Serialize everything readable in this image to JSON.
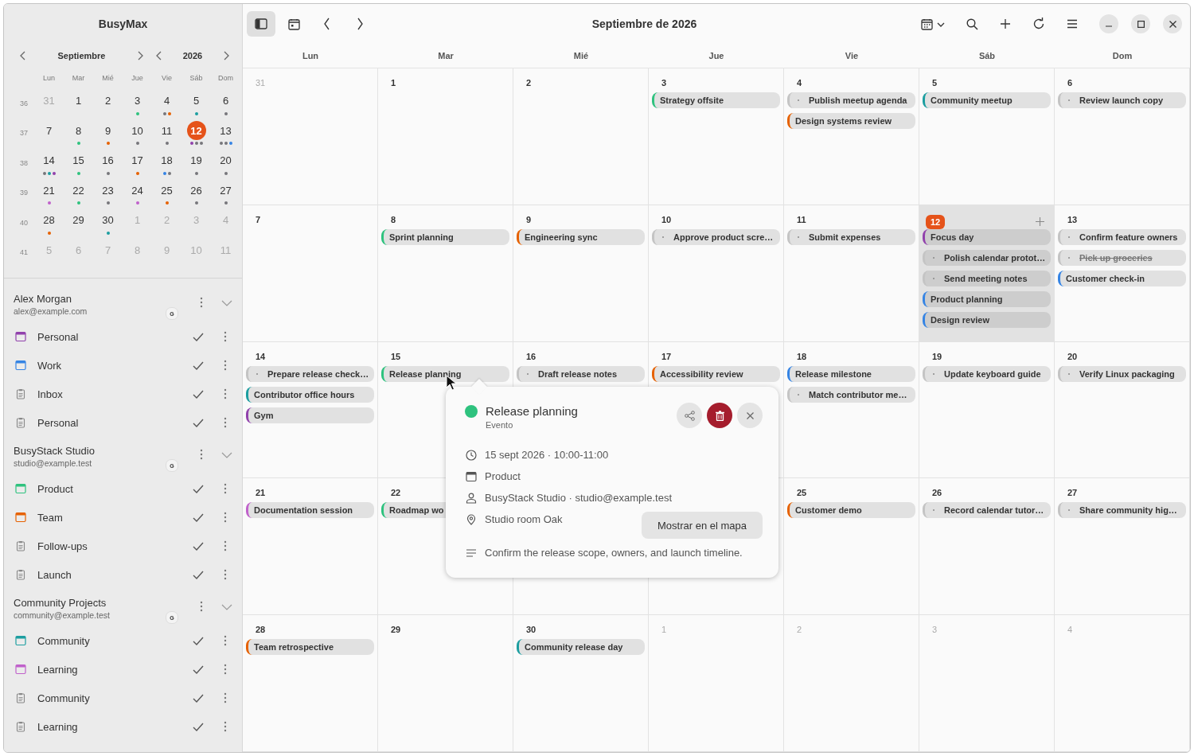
{
  "sidebar": {
    "app_title": "BusyMax",
    "mini_calendar": {
      "month": "Septiembre",
      "year": "2026",
      "weekdays": [
        "Lun",
        "Mar",
        "Mié",
        "Jue",
        "Vie",
        "Sáb",
        "Dom"
      ],
      "weeks": [
        {
          "number": "36",
          "days": [
            {
              "label": "31",
              "outside": true,
              "today": false
            },
            {
              "label": "1",
              "outside": false,
              "today": false
            },
            {
              "label": "2",
              "outside": false,
              "today": false
            },
            {
              "label": "3",
              "outside": false,
              "today": false,
              "dots": [
                {
                  "color": "#2ec27e"
                }
              ]
            },
            {
              "label": "4",
              "outside": false,
              "today": false,
              "dots": [
                {
                  "color": "#77767b"
                },
                {
                  "color": "#e66100"
                }
              ]
            },
            {
              "label": "5",
              "outside": false,
              "today": false,
              "dots": [
                {
                  "color": "#1c9ea0"
                }
              ]
            },
            {
              "label": "6",
              "outside": false,
              "today": false,
              "dots": [
                {
                  "color": "#77767b"
                }
              ]
            }
          ]
        },
        {
          "number": "37",
          "days": [
            {
              "label": "7",
              "outside": false,
              "today": false
            },
            {
              "label": "8",
              "outside": false,
              "today": false,
              "dots": [
                {
                  "color": "#2ec27e"
                }
              ]
            },
            {
              "label": "9",
              "outside": false,
              "today": false,
              "dots": [
                {
                  "color": "#e66100"
                }
              ]
            },
            {
              "label": "10",
              "outside": false,
              "today": false,
              "dots": [
                {
                  "color": "#77767b"
                }
              ]
            },
            {
              "label": "11",
              "outside": false,
              "today": false,
              "dots": [
                {
                  "color": "#77767b"
                }
              ]
            },
            {
              "label": "12",
              "outside": false,
              "today": true,
              "dots": [
                {
                  "color": "#9141ac"
                },
                {
                  "color": "#77767b"
                },
                {
                  "color": "#77767b"
                }
              ]
            },
            {
              "label": "13",
              "outside": false,
              "today": false,
              "dots": [
                {
                  "color": "#77767b"
                },
                {
                  "color": "#77767b"
                },
                {
                  "color": "#3584e4"
                }
              ]
            }
          ]
        },
        {
          "number": "38",
          "days": [
            {
              "label": "14",
              "outside": false,
              "today": false,
              "dots": [
                {
                  "color": "#77767b"
                },
                {
                  "color": "#1c9ea0"
                },
                {
                  "color": "#9141ac"
                }
              ]
            },
            {
              "label": "15",
              "outside": false,
              "today": false,
              "dots": [
                {
                  "color": "#2ec27e"
                }
              ]
            },
            {
              "label": "16",
              "outside": false,
              "today": false,
              "dots": [
                {
                  "color": "#77767b"
                }
              ]
            },
            {
              "label": "17",
              "outside": false,
              "today": false,
              "dots": [
                {
                  "color": "#e66100"
                }
              ]
            },
            {
              "label": "18",
              "outside": false,
              "today": false,
              "dots": [
                {
                  "color": "#3584e4"
                },
                {
                  "color": "#77767b"
                }
              ]
            },
            {
              "label": "19",
              "outside": false,
              "today": false,
              "dots": [
                {
                  "color": "#77767b"
                }
              ]
            },
            {
              "label": "20",
              "outside": false,
              "today": false,
              "dots": [
                {
                  "color": "#77767b"
                }
              ]
            }
          ]
        },
        {
          "number": "39",
          "days": [
            {
              "label": "21",
              "outside": false,
              "today": false,
              "dots": [
                {
                  "color": "#c061cb"
                }
              ]
            },
            {
              "label": "22",
              "outside": false,
              "today": false,
              "dots": [
                {
                  "color": "#2ec27e"
                }
              ]
            },
            {
              "label": "23",
              "outside": false,
              "today": false,
              "dots": [
                {
                  "color": "#77767b"
                }
              ]
            },
            {
              "label": "24",
              "outside": false,
              "today": false,
              "dots": [
                {
                  "color": "#c061cb"
                }
              ]
            },
            {
              "label": "25",
              "outside": false,
              "today": false,
              "dots": [
                {
                  "color": "#e66100"
                }
              ]
            },
            {
              "label": "26",
              "outside": false,
              "today": false,
              "dots": [
                {
                  "color": "#77767b"
                }
              ]
            },
            {
              "label": "27",
              "outside": false,
              "today": false,
              "dots": [
                {
                  "color": "#77767b"
                }
              ]
            }
          ]
        },
        {
          "number": "40",
          "days": [
            {
              "label": "28",
              "outside": false,
              "today": false,
              "dots": [
                {
                  "color": "#e66100"
                }
              ]
            },
            {
              "label": "29",
              "outside": false,
              "today": false
            },
            {
              "label": "30",
              "outside": false,
              "today": false,
              "dots": [
                {
                  "color": "#1c9ea0"
                }
              ]
            },
            {
              "label": "1",
              "outside": true,
              "today": false
            },
            {
              "label": "2",
              "outside": true,
              "today": false
            },
            {
              "label": "3",
              "outside": true,
              "today": false
            },
            {
              "label": "4",
              "outside": true,
              "today": false
            }
          ]
        },
        {
          "number": "41",
          "days": [
            {
              "label": "5",
              "outside": true,
              "today": false
            },
            {
              "label": "6",
              "outside": true,
              "today": false
            },
            {
              "label": "7",
              "outside": true,
              "today": false
            },
            {
              "label": "8",
              "outside": true,
              "today": false
            },
            {
              "label": "9",
              "outside": true,
              "today": false
            },
            {
              "label": "10",
              "outside": true,
              "today": false
            },
            {
              "label": "11",
              "outside": true,
              "today": false
            }
          ]
        }
      ]
    },
    "accounts": [
      {
        "name": "Alex Morgan",
        "email": "alex@example.com",
        "badge": "G",
        "calendars": [
          {
            "kind": "calendar",
            "name": "Personal",
            "color": "#9141ac",
            "checked": true
          },
          {
            "kind": "calendar",
            "name": "Work",
            "color": "#3584e4",
            "checked": true
          },
          {
            "kind": "tasklist",
            "name": "Inbox",
            "checked": true
          },
          {
            "kind": "tasklist",
            "name": "Personal",
            "checked": true
          }
        ]
      },
      {
        "name": "BusyStack Studio",
        "email": "studio@example.test",
        "badge": "G",
        "calendars": [
          {
            "kind": "calendar",
            "name": "Product",
            "color": "#2ec27e",
            "checked": true
          },
          {
            "kind": "calendar",
            "name": "Team",
            "color": "#e66100",
            "checked": true
          },
          {
            "kind": "tasklist",
            "name": "Follow-ups",
            "checked": true
          },
          {
            "kind": "tasklist",
            "name": "Launch",
            "checked": true
          }
        ]
      },
      {
        "name": "Community Projects",
        "email": "community@example.test",
        "badge": "G",
        "calendars": [
          {
            "kind": "calendar",
            "name": "Community",
            "color": "#1c9ea0",
            "checked": true
          },
          {
            "kind": "calendar",
            "name": "Learning",
            "color": "#c061cb",
            "checked": true
          },
          {
            "kind": "tasklist",
            "name": "Community",
            "checked": true
          },
          {
            "kind": "tasklist",
            "name": "Learning",
            "checked": true
          }
        ]
      }
    ]
  },
  "toolbar": {
    "title": "Septiembre de 2026",
    "sidebar_toggle_selected": true
  },
  "month_view": {
    "weekdays": [
      "Lun",
      "Mar",
      "Mié",
      "Jue",
      "Vie",
      "Sáb",
      "Dom"
    ],
    "weeks": [
      {
        "days": [
          {
            "kind": "day",
            "label": "31",
            "outside": true,
            "today": false
          },
          {
            "kind": "day",
            "label": "1",
            "outside": false,
            "today": false
          },
          {
            "kind": "day",
            "label": "2",
            "outside": false,
            "today": false
          },
          {
            "kind": "day",
            "label": "3",
            "outside": false,
            "today": false,
            "events": [
              {
                "kind": "event",
                "title": "Strategy offsite",
                "color": "#2ec27e"
              }
            ]
          },
          {
            "kind": "day",
            "label": "4",
            "outside": false,
            "today": false,
            "events": [
              {
                "kind": "task",
                "title": "Publish meetup agenda",
                "done": false
              },
              {
                "kind": "event",
                "title": "Design systems review",
                "color": "#e66100"
              }
            ]
          },
          {
            "kind": "day",
            "label": "5",
            "outside": false,
            "today": false,
            "events": [
              {
                "kind": "event",
                "title": "Community meetup",
                "color": "#1c9ea0"
              }
            ]
          },
          {
            "kind": "day",
            "label": "6",
            "outside": false,
            "today": false,
            "events": [
              {
                "kind": "task",
                "title": "Review launch copy",
                "done": false
              }
            ]
          }
        ]
      },
      {
        "days": [
          {
            "kind": "day",
            "label": "7",
            "outside": false,
            "today": false
          },
          {
            "kind": "day",
            "label": "8",
            "outside": false,
            "today": false,
            "events": [
              {
                "kind": "event",
                "title": "Sprint planning",
                "color": "#2ec27e"
              }
            ]
          },
          {
            "kind": "day",
            "label": "9",
            "outside": false,
            "today": false,
            "events": [
              {
                "kind": "event",
                "title": "Engineering sync",
                "color": "#e66100"
              }
            ]
          },
          {
            "kind": "day",
            "label": "10",
            "outside": false,
            "today": false,
            "events": [
              {
                "kind": "task",
                "title": "Approve product scre…",
                "done": false
              }
            ]
          },
          {
            "kind": "day",
            "label": "11",
            "outside": false,
            "today": false,
            "events": [
              {
                "kind": "task",
                "title": "Submit expenses",
                "done": false
              }
            ]
          },
          {
            "kind": "day",
            "label": "12",
            "outside": false,
            "today": true,
            "events": [
              {
                "kind": "event",
                "title": "Focus day",
                "color": "#9141ac"
              },
              {
                "kind": "task",
                "title": "Polish calendar protot…",
                "done": false
              },
              {
                "kind": "task",
                "title": "Send meeting notes",
                "done": false
              },
              {
                "kind": "event",
                "title": "Product planning",
                "color": "#3584e4"
              },
              {
                "kind": "event",
                "title": "Design review",
                "color": "#3584e4"
              }
            ]
          },
          {
            "kind": "day",
            "label": "13",
            "outside": false,
            "today": false,
            "events": [
              {
                "kind": "task",
                "title": "Confirm feature owners",
                "done": false
              },
              {
                "kind": "task",
                "title": "Pick up groceries",
                "done": true
              },
              {
                "kind": "event",
                "title": "Customer check-in",
                "color": "#3584e4"
              }
            ]
          }
        ]
      },
      {
        "days": [
          {
            "kind": "day",
            "label": "14",
            "outside": false,
            "today": false,
            "events": [
              {
                "kind": "task",
                "title": "Prepare release check…",
                "done": false
              },
              {
                "kind": "event",
                "title": "Contributor office hours",
                "color": "#1c9ea0"
              },
              {
                "kind": "event",
                "title": "Gym",
                "color": "#9141ac"
              }
            ]
          },
          {
            "kind": "day",
            "label": "15",
            "outside": false,
            "today": false,
            "events": [
              {
                "kind": "event",
                "title": "Release planning",
                "color": "#2ec27e"
              }
            ]
          },
          {
            "kind": "day",
            "label": "16",
            "outside": false,
            "today": false,
            "events": [
              {
                "kind": "task",
                "title": "Draft release notes",
                "done": false
              }
            ]
          },
          {
            "kind": "day",
            "label": "17",
            "outside": false,
            "today": false,
            "events": [
              {
                "kind": "event",
                "title": "Accessibility review",
                "color": "#e66100"
              }
            ]
          },
          {
            "kind": "day",
            "label": "18",
            "outside": false,
            "today": false,
            "events": [
              {
                "kind": "event",
                "title": "Release milestone",
                "color": "#3584e4"
              },
              {
                "kind": "task",
                "title": "Match contributor me…",
                "done": false
              }
            ]
          },
          {
            "kind": "day",
            "label": "19",
            "outside": false,
            "today": false,
            "events": [
              {
                "kind": "task",
                "title": "Update keyboard guide",
                "done": false
              }
            ]
          },
          {
            "kind": "day",
            "label": "20",
            "outside": false,
            "today": false,
            "events": [
              {
                "kind": "task",
                "title": "Verify Linux packaging",
                "done": false
              }
            ]
          }
        ]
      },
      {
        "days": [
          {
            "kind": "day",
            "label": "21",
            "outside": false,
            "today": false,
            "events": [
              {
                "kind": "event",
                "title": "Documentation session",
                "color": "#c061cb"
              }
            ]
          },
          {
            "kind": "day",
            "label": "22",
            "outside": false,
            "today": false,
            "events": [
              {
                "kind": "event",
                "title": "Roadmap wo",
                "color": "#2ec27e"
              }
            ]
          },
          {
            "kind": "covered"
          },
          {
            "kind": "covered"
          },
          {
            "kind": "day",
            "label": "25",
            "outside": false,
            "today": false,
            "events": [
              {
                "kind": "event",
                "title": "Customer demo",
                "color": "#e66100"
              }
            ]
          },
          {
            "kind": "day",
            "label": "26",
            "outside": false,
            "today": false,
            "events": [
              {
                "kind": "task",
                "title": "Record calendar tutor…",
                "done": false
              }
            ]
          },
          {
            "kind": "day",
            "label": "27",
            "outside": false,
            "today": false,
            "events": [
              {
                "kind": "task",
                "title": "Share community hig…",
                "done": false
              }
            ]
          }
        ]
      },
      {
        "days": [
          {
            "kind": "day",
            "label": "28",
            "outside": false,
            "today": false,
            "events": [
              {
                "kind": "event",
                "title": "Team retrospective",
                "color": "#e66100"
              }
            ]
          },
          {
            "kind": "day",
            "label": "29",
            "outside": false,
            "today": false
          },
          {
            "kind": "day",
            "label": "30",
            "outside": false,
            "today": false,
            "events": [
              {
                "kind": "event",
                "title": "Community release day",
                "color": "#1c9ea0"
              }
            ]
          },
          {
            "kind": "day",
            "label": "1",
            "outside": true,
            "today": false
          },
          {
            "kind": "day",
            "label": "2",
            "outside": true,
            "today": false
          },
          {
            "kind": "day",
            "label": "3",
            "outside": true,
            "today": false
          },
          {
            "kind": "day",
            "label": "4",
            "outside": true,
            "today": false
          }
        ]
      }
    ]
  },
  "popover": {
    "title": "Release planning",
    "subtitle": "Evento",
    "color": "#2ec27e",
    "when": "15 sept 2026 · 10:00-11:00",
    "calendar": "Product",
    "account": "BusyStack Studio · studio@example.test",
    "location": "Studio room Oak",
    "map_button": "Mostrar en el mapa",
    "description": "Confirm the release scope, owners, and launch timeline."
  }
}
